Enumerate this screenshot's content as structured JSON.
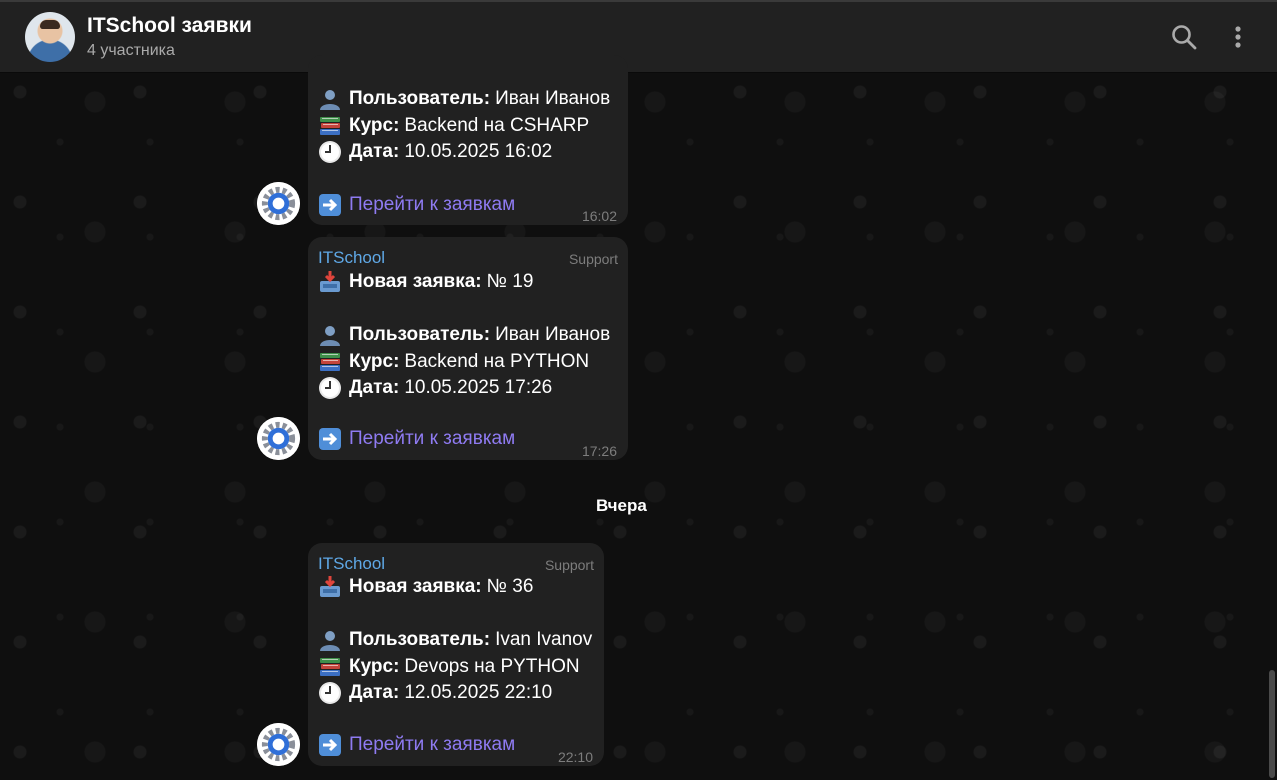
{
  "header": {
    "title": "ITSchool заявки",
    "subtitle": "4 участника",
    "icons": {
      "search": "search-icon",
      "more": "more-vertical-icon"
    }
  },
  "colors": {
    "sender": "#5fa8e6",
    "link": "#8f7bf2",
    "bubble": "#212121",
    "header": "#212121"
  },
  "messages": [
    {
      "user_label": "Пользователь:",
      "user": "Иван Иванов",
      "course_label": "Курс:",
      "course": "Backend на CSHARP",
      "date_label": "Дата:",
      "date": "10.05.2025 16:02",
      "link": "Перейти к заявкам",
      "time": "16:02"
    },
    {
      "sender": "ITSchool",
      "tag": "Support",
      "title_label": "Новая заявка:",
      "number": "№ 19",
      "user_label": "Пользователь:",
      "user": "Иван Иванов",
      "course_label": "Курс:",
      "course": "Backend на PYTHON",
      "date_label": "Дата:",
      "date": "10.05.2025 17:26",
      "link": "Перейти к заявкам",
      "time": "17:26"
    },
    {
      "sender": "ITSchool",
      "tag": "Support",
      "title_label": "Новая заявка:",
      "number": "№ 36",
      "user_label": "Пользователь:",
      "user": "Ivan Ivanov",
      "course_label": "Курс:",
      "course": "Devops на PYTHON",
      "date_label": "Дата:",
      "date": "12.05.2025 22:10",
      "link": "Перейти к заявкам",
      "time": "22:10"
    }
  ],
  "date_separator": "Вчера"
}
